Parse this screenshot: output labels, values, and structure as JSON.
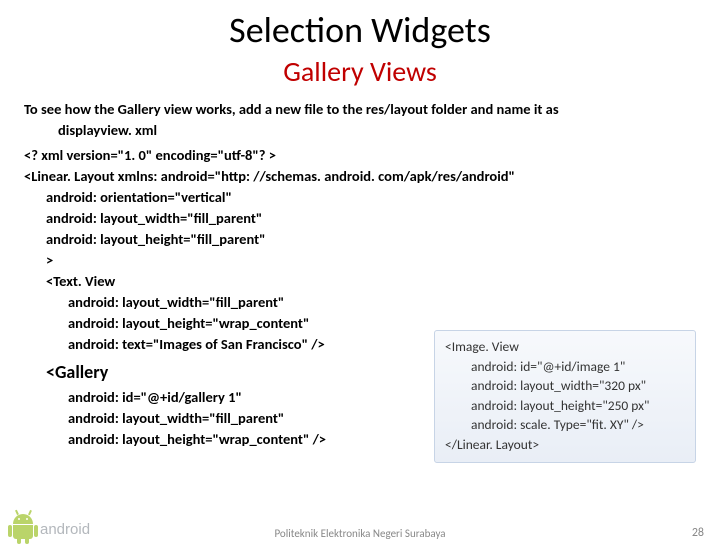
{
  "title": "Selection Widgets",
  "subtitle": "Gallery Views",
  "intro_line1": "To see how the Gallery view works, add a new file to the res/layout folder and name it as",
  "intro_line2": "displayview. xml",
  "code": {
    "l1": "<? xml version=\"1. 0\" encoding=\"utf-8\"? >",
    "l2": "<Linear. Layout xmlns: android=\"http: //schemas. android. com/apk/res/android\"",
    "l3": "android: orientation=\"vertical\"",
    "l4": "android: layout_width=\"fill_parent\"",
    "l5": "android: layout_height=\"fill_parent\"",
    "l6": ">",
    "l7": "<Text. View",
    "l8": "android: layout_width=\"fill_parent\"",
    "l9": "android: layout_height=\"wrap_content\"",
    "l10": "android: text=\"Images of San Francisco\" />",
    "gallery": "<Gallery",
    "g1": "android: id=\"@+id/gallery 1\"",
    "g2": "android: layout_width=\"fill_parent\"",
    "g3": "android: layout_height=\"wrap_content\" />"
  },
  "rightbox": {
    "r1": "<Image. View",
    "r2": "android: id=\"@+id/image 1\"",
    "r3": "android: layout_width=\"320 px\"",
    "r4": "android: layout_height=\"250 px\"",
    "r5": "android: scale. Type=\"fit. XY\" />",
    "r6": "</Linear. Layout>"
  },
  "footer": "Politeknik Elektronika Negeri Surabaya",
  "page": "28",
  "logo_text": "android"
}
